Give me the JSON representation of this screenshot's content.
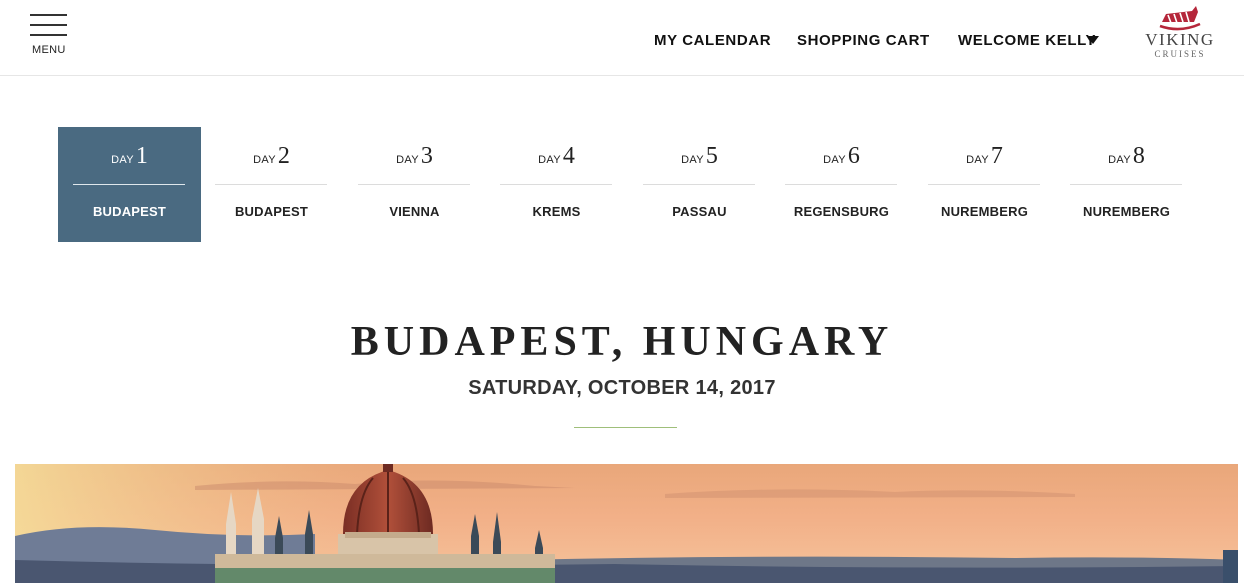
{
  "header": {
    "menu_label": "MENU",
    "nav": {
      "calendar": "MY CALENDAR",
      "cart": "SHOPPING CART",
      "welcome": "WELCOME KELLY"
    },
    "logo": {
      "word": "VIKING",
      "sub": "CRUISES"
    }
  },
  "days": [
    {
      "word": "DAY",
      "number": "1",
      "city": "BUDAPEST",
      "active": true
    },
    {
      "word": "DAY",
      "number": "2",
      "city": "BUDAPEST",
      "active": false
    },
    {
      "word": "DAY",
      "number": "3",
      "city": "VIENNA",
      "active": false
    },
    {
      "word": "DAY",
      "number": "4",
      "city": "KREMS",
      "active": false
    },
    {
      "word": "DAY",
      "number": "5",
      "city": "PASSAU",
      "active": false
    },
    {
      "word": "DAY",
      "number": "6",
      "city": "REGENSBURG",
      "active": false
    },
    {
      "word": "DAY",
      "number": "7",
      "city": "NUREMBERG",
      "active": false
    },
    {
      "word": "DAY",
      "number": "8",
      "city": "NUREMBERG",
      "active": false
    }
  ],
  "main": {
    "title": "BUDAPEST, HUNGARY",
    "date": "SATURDAY, OCTOBER 14, 2017"
  },
  "colors": {
    "active_tab": "#4a6a81",
    "accent_rule": "#9fbf7a",
    "logo_red": "#b5263a"
  },
  "icons": {
    "menu": "hamburger-icon",
    "dropdown": "caret-down-icon",
    "logo": "viking-ship-logo"
  }
}
